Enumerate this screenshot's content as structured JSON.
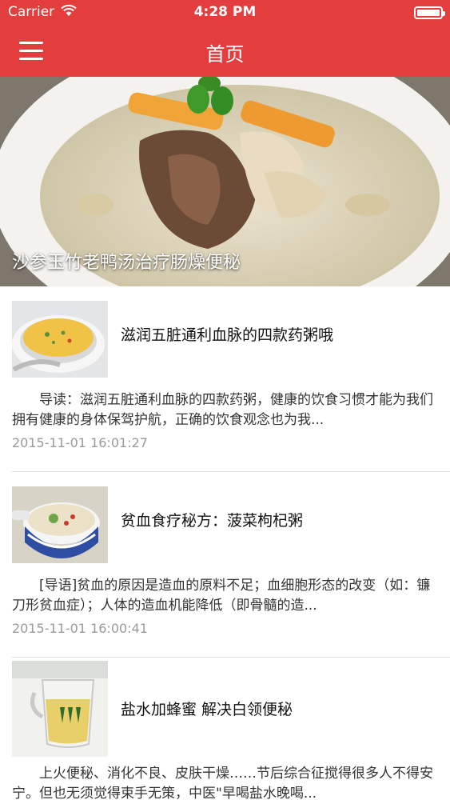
{
  "status_bar": {
    "carrier": "Carrier",
    "time": "4:28 PM"
  },
  "nav": {
    "title": "首页",
    "menu_icon": "hamburger-menu-icon"
  },
  "hero": {
    "caption": "沙参玉竹老鸭汤治疗肠燥便秘"
  },
  "articles": [
    {
      "title": "滋润五脏通利血脉的四款药粥哦",
      "summary": "导读：滋润五脏通利血脉的四款药粥，健康的饮食习惯才能为我们拥有健康的身体保驾护航，正确的饮食观念也为我...",
      "date": "2015-11-01 16:01:27"
    },
    {
      "title": "贫血食疗秘方：菠菜枸杞粥",
      "summary": "[导语]贫血的原因是造血的原料不足；血细胞形态的改变（如：镰刀形贫血症）；人体的造血机能降低（即骨髓的造...",
      "date": "2015-11-01 16:00:41"
    },
    {
      "title": "盐水加蜂蜜 解决白领便秘",
      "summary": "上火便秘、消化不良、皮肤干燥……节后综合征搅得很多人不得安宁。但也无须觉得束手无策，中医\"早喝盐水晚喝..."
    }
  ],
  "colors": {
    "accent": "#e33d3d"
  }
}
